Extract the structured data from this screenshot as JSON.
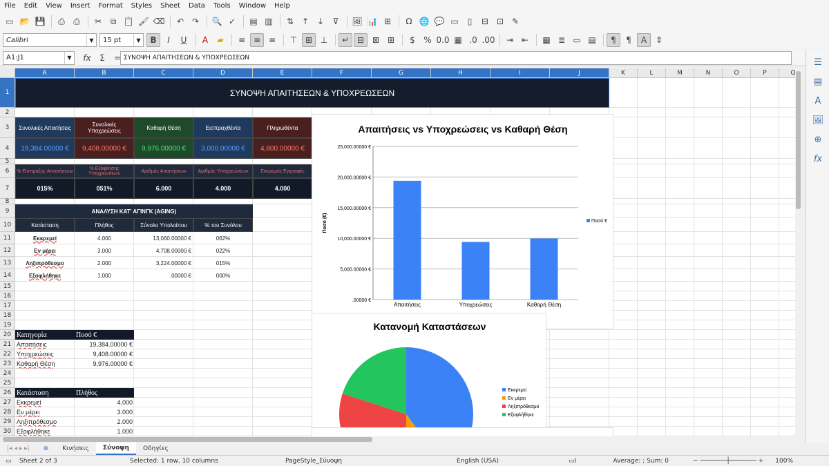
{
  "menu": [
    "File",
    "Edit",
    "View",
    "Insert",
    "Format",
    "Styles",
    "Sheet",
    "Data",
    "Tools",
    "Window",
    "Help"
  ],
  "toolbar": {
    "font_name": "Calibri",
    "font_size": "15 pt"
  },
  "formula_bar": {
    "name_box": "A1:J1",
    "content": "ΣΥΝΟΨΗ ΑΠΑΙΤΗΣΕΩΝ & ΥΠΟΧΡΕΩΣΕΩΝ"
  },
  "columns": [
    "A",
    "B",
    "C",
    "D",
    "E",
    "F",
    "G",
    "H",
    "I",
    "J",
    "K",
    "L",
    "M",
    "N",
    "O",
    "P",
    "Q"
  ],
  "rows": [
    "1",
    "2",
    "3",
    "4",
    "5",
    "6",
    "7",
    "8",
    "9",
    "10",
    "11",
    "12",
    "13",
    "14",
    "15",
    "16",
    "17",
    "18",
    "19",
    "20",
    "21",
    "22",
    "23",
    "24",
    "25",
    "26",
    "27",
    "28",
    "29",
    "30"
  ],
  "sheet": {
    "title": "ΣΥΝΟΨΗ ΑΠΑΙΤΗΣΕΩΝ & ΥΠΟΧΡΕΩΣΕΩΝ",
    "kpi_headers": [
      "Συνολικές Απαιτήσεις",
      "Συνολικές Υποχρεώσεις",
      "Καθαρή Θέση",
      "Εισπραχθέντα",
      "Πληρωθέντα"
    ],
    "kpi_values": [
      "19,384.00000 €",
      "9,408.00000 €",
      "9,976.00000 €",
      "3,000.00000 €",
      "4,800.00000 €"
    ],
    "kpi_colors": [
      "#5aa0ff",
      "#ff7a66",
      "#4fe07a",
      "#5aa0ff",
      "#ff7a66"
    ],
    "kpi_bg": [
      "#1f3a5c",
      "#4a1f1f",
      "#1f4a2a",
      "#1f3a5c",
      "#4a1f1f"
    ],
    "ratio_headers": [
      "% Είσπραξης Απαιτήσεων",
      "% Εξόφλησης Υποχρεώσεων",
      "Αριθμός Απαιτήσεων",
      "Αριθμός Υποχρεώσεων",
      "Εκκρεμείς Εγγραφές"
    ],
    "ratio_values": [
      "015%",
      "051%",
      "6.000",
      "4.000",
      "4.000"
    ],
    "aging_title": "ΑΝΑΛΥΣΗ ΚΑΤ' ΑΓΙΝΓΚ (AGING)",
    "aging_headers": [
      "Κατάσταση",
      "Πλήθος",
      "Σύνολο Υπολοίπου",
      "% του Συνόλου"
    ],
    "aging_rows": [
      [
        "Εκκρεμεί",
        "4.000",
        "13,060.00000 €",
        "062%"
      ],
      [
        "Εν μέρει",
        "3.000",
        "4,708.00000 €",
        "022%"
      ],
      [
        "Ληξιπρόθεσμο",
        "2.000",
        "3,224.00000 €",
        "015%"
      ],
      [
        "Εξοφλήθηκε",
        "1.000",
        ".00000 €",
        "000%"
      ]
    ],
    "cat_headers": [
      "Κατηγορία",
      "Ποσό €"
    ],
    "cat_rows": [
      [
        "Απαιτήσεις",
        "19,384.00000 €"
      ],
      [
        "Υποχρεώσεις",
        "9,408.00000 €"
      ],
      [
        "Καθαρή Θέση",
        "9,976.00000 €"
      ]
    ],
    "status_headers": [
      "Κατάσταση",
      "Πλήθος"
    ],
    "status_rows": [
      [
        "Εκκρεμεί",
        "4.000"
      ],
      [
        "Εν μέρει",
        "3.000"
      ],
      [
        "Ληξιπρόθεσμο",
        "2.000"
      ],
      [
        "Εξοφλήθηκε",
        "1.000"
      ]
    ]
  },
  "chart_data": [
    {
      "type": "bar",
      "title": "Απαιτήσεις vs Υποχρεώσεις vs Καθαρή Θέση",
      "ylabel": "Ποσό (€)",
      "categories": [
        "Απαιτήσεις",
        "Υποχρεώσεις",
        "Καθαρή Θέση"
      ],
      "series": [
        {
          "name": "Ποσό €",
          "values": [
            19384,
            9408,
            9976
          ],
          "color": "#3b82f6"
        }
      ],
      "ylim": [
        0,
        25000
      ],
      "yticks": [
        "25,000.00000 €",
        "20,000.00000 €",
        "15,000.00000 €",
        "10,000.00000 €",
        "5,000.00000 €",
        ".00000 €"
      ],
      "grid": true,
      "legend": "right"
    },
    {
      "type": "pie",
      "title": "Κατανομή Καταστάσεων",
      "categories": [
        "Εκκρεμεί",
        "Εν μέρει",
        "Ληξιπρόθεσμο",
        "Εξοφλήθηκε"
      ],
      "values": [
        4,
        1,
        3,
        2
      ],
      "colors": [
        "#3b82f6",
        "#f59e0b",
        "#ef4444",
        "#22c55e"
      ],
      "legend": "right"
    }
  ],
  "tabs": [
    "Κινήσεις",
    "Σύνοψη",
    "Οδηγίες"
  ],
  "status": {
    "sheet": "Sheet 2 of 3",
    "selection": "Selected: 1 row, 10 columns",
    "page_style": "PageStyle_Σύνοψη",
    "language": "English (USA)",
    "stats": "Average: ; Sum: 0",
    "zoom": "100%"
  }
}
